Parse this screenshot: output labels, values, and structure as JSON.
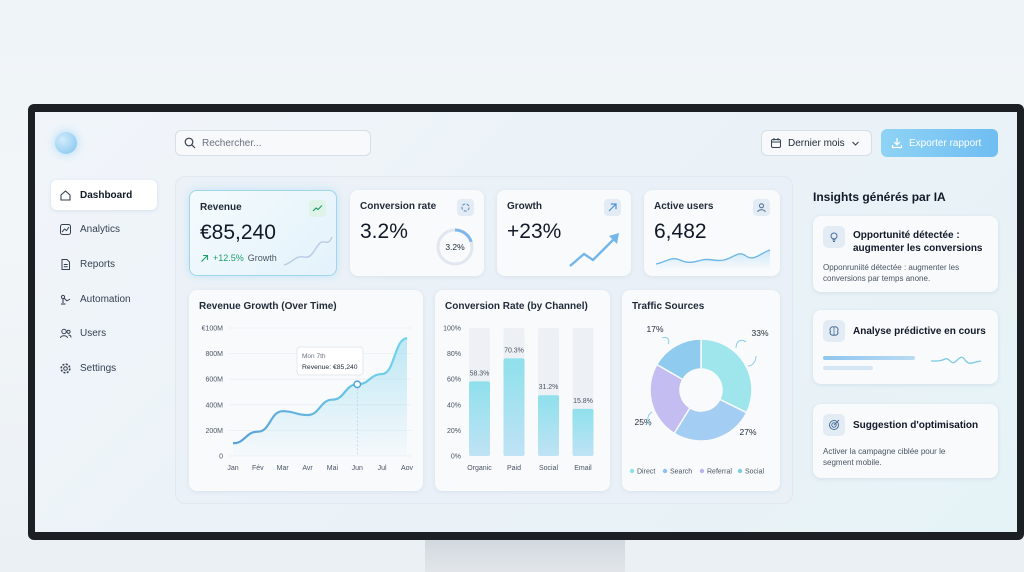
{
  "search": {
    "placeholder": "Rechercher..."
  },
  "header": {
    "period_label": "Dernier mois",
    "export_label": "Exporter rapport"
  },
  "sidebar": {
    "items": [
      {
        "label": "Dashboard",
        "icon": "home-icon",
        "active": true
      },
      {
        "label": "Analytics",
        "icon": "analytics-icon"
      },
      {
        "label": "Reports",
        "icon": "document-icon"
      },
      {
        "label": "Automation",
        "icon": "robot-arm-icon"
      },
      {
        "label": "Users",
        "icon": "users-icon"
      },
      {
        "label": "Settings",
        "icon": "gear-icon"
      }
    ]
  },
  "kpis": [
    {
      "title": "Revenue",
      "value": "€85,240",
      "delta": "+12.5%",
      "delta_label": "Growth",
      "icon": "trend-icon"
    },
    {
      "title": "Conversion rate",
      "value": "3.2%",
      "ring_label": "3.2%",
      "icon": "refresh-icon"
    },
    {
      "title": "Growth",
      "value": "+23%",
      "icon": "arrow-up-right-icon"
    },
    {
      "title": "Active users",
      "value": "6,482",
      "icon": "user-icon"
    }
  ],
  "revenue_chart": {
    "title": "Revenue Growth (Over Time)",
    "tooltip": {
      "line1": "Mon 7th",
      "line2": "Revenue: €85,240"
    },
    "chart_data": {
      "type": "area",
      "categories": [
        "Jan",
        "Fév",
        "Mar",
        "Avr",
        "Mai",
        "Jun",
        "Jul",
        "Aov"
      ],
      "y_ticks": [
        "€100M",
        "800M",
        "600M",
        "400M",
        "200M",
        "0"
      ],
      "values": [
        10,
        19,
        35,
        32,
        44,
        56,
        64,
        92
      ],
      "highlight_index": 5
    }
  },
  "conversion_chart": {
    "title": "Conversion Rate (by Channel)",
    "chart_data": {
      "type": "bar",
      "categories": [
        "Organic",
        "Paid",
        "Social",
        "Email"
      ],
      "values": [
        58.3,
        76.3,
        47.5,
        36.8
      ],
      "labels": [
        "58.3%",
        "70.3%",
        "31.2%",
        "15.8%"
      ],
      "y_ticks": [
        "100%",
        "80%",
        "60%",
        "40%",
        "20%",
        "0%"
      ]
    }
  },
  "traffic_chart": {
    "title": "Traffic Sources",
    "chart_data": {
      "type": "pie",
      "categories": [
        "Direct",
        "Search",
        "Referral",
        "Social"
      ],
      "values": [
        33,
        27,
        25,
        17
      ],
      "labels": [
        "33%",
        "27%",
        "25%",
        "17%"
      ],
      "colors": [
        "#8ee0e8",
        "#8fc0f2",
        "#b9b2f0",
        "#7fd0df"
      ]
    }
  },
  "insights": {
    "title": "Insights générés par IA",
    "cards": [
      {
        "title_line1": "Opportunité détectée :",
        "title_line2": "augmenter les conversions",
        "text_line1": "Opponruniité détectée : augmenter les",
        "text_line2": "conversions par temps anone.",
        "icon": "lightbulb-icon"
      },
      {
        "title_line1": "Analyse prédictive en cours",
        "icon": "brain-icon"
      },
      {
        "title_line1": "Suggestion d'optimisation",
        "text_line1": "Activer la campagne ciblée pour le",
        "text_line2": "segment mobile.",
        "icon": "target-icon"
      }
    ]
  }
}
